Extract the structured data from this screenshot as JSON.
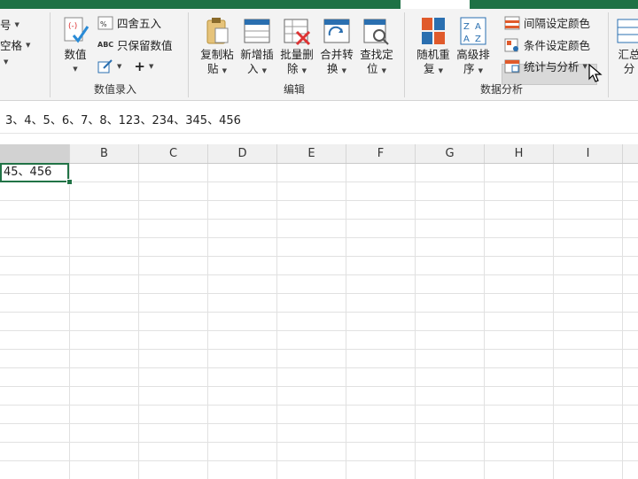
{
  "ribbon": {
    "left_partial": {
      "item1": "号",
      "item2": "空格",
      "item3": ""
    },
    "numeric_group": {
      "big_button": "数值",
      "round_button": "四舍五入",
      "keep_numeric_button": "只保留数值",
      "label": "数值录入"
    },
    "edit_group": {
      "buttons": [
        {
          "line1": "复制粘",
          "line2": "贴"
        },
        {
          "line1": "新增插",
          "line2": "入"
        },
        {
          "line1": "批量删",
          "line2": "除"
        },
        {
          "line1": "合并转",
          "line2": "换"
        },
        {
          "line1": "查找定",
          "line2": "位"
        }
      ],
      "label": "编辑"
    },
    "data_group": {
      "random_button": {
        "line1": "随机重",
        "line2": "复"
      },
      "sort_button": {
        "line1": "高级排",
        "line2": "序"
      },
      "interval_color_button": "间隔设定颜色",
      "condition_color_button": "条件设定颜色",
      "stats_button": "统计与分析",
      "label": "数据分析"
    },
    "summary_partial": {
      "line1": "汇总",
      "line2": "分"
    }
  },
  "formula_bar": {
    "content": "3、4、5、6、7、8、123、234、345、456"
  },
  "sheet": {
    "columns": [
      "B",
      "C",
      "D",
      "E",
      "F",
      "G",
      "H",
      "I"
    ],
    "selected_cell_text": "45、456"
  },
  "colors": {
    "accent_green": "#217346",
    "title_green": "#1e7145"
  },
  "icons": {
    "stepper_plus": "+",
    "arrow": "▾"
  }
}
